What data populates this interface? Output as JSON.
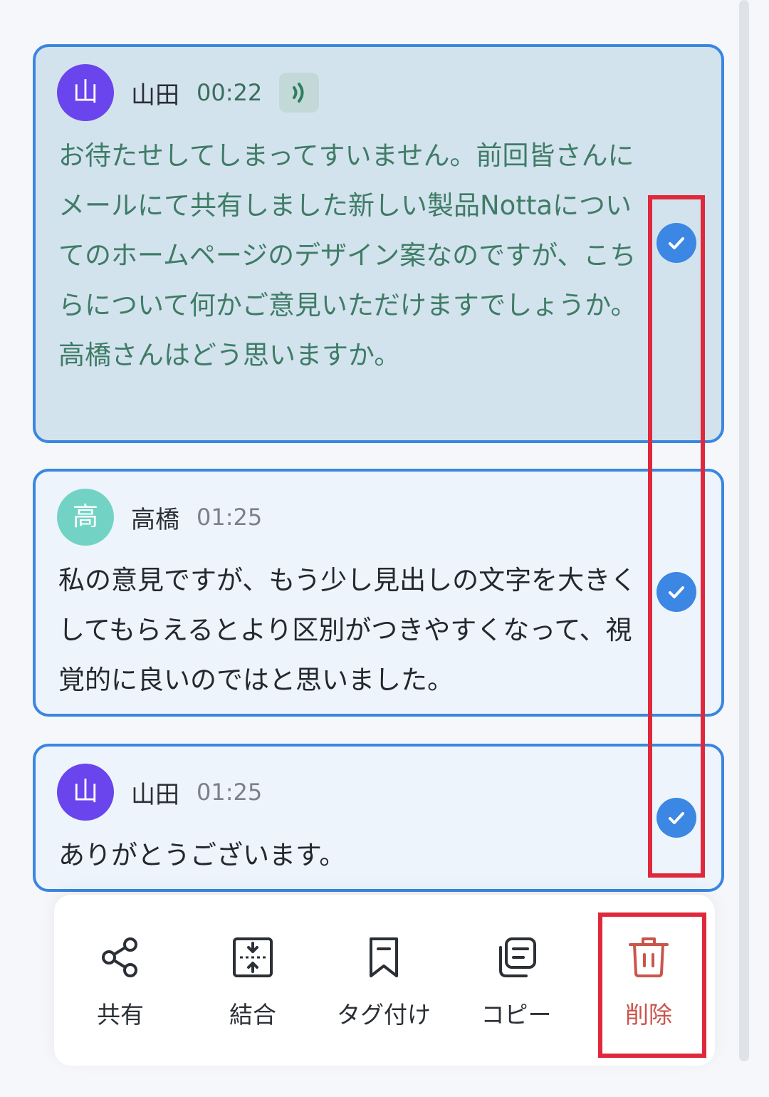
{
  "colors": {
    "selection_border": "#3a86e0",
    "check_blue": "#3b87e3",
    "highlight_red": "#e0283c",
    "delete_red": "#c9554d",
    "avatar_yamada": "#6a44ec",
    "avatar_takahashi": "#72d3c5"
  },
  "transcript": [
    {
      "avatar_char": "山",
      "speaker": "山田",
      "time": "00:22",
      "playing_icon": "audio-wave-icon",
      "text": "お待たせしてしまってすいません。前回皆さんにメールにて共有しました新しい製品Nottaについてのホームページのデザイン案なのですが、こちらについて何かご意見いただけますでしょうか。高橋さんはどう思いますか。",
      "selected": true
    },
    {
      "avatar_char": "高",
      "speaker": "高橋",
      "time": "01:25",
      "text": "私の意見ですが、もう少し見出しの文字を大きくしてもらえるとより区別がつきやすくなって、視覚的に良いのではと思いました。",
      "selected": true
    },
    {
      "avatar_char": "山",
      "speaker": "山田",
      "time": "01:25",
      "text": "ありがとうございます。",
      "selected": true
    }
  ],
  "toolbar": {
    "items": [
      {
        "label": "共有",
        "icon": "share-icon"
      },
      {
        "label": "結合",
        "icon": "merge-icon"
      },
      {
        "label": "タグ付け",
        "icon": "bookmark-icon"
      },
      {
        "label": "コピー",
        "icon": "copy-icon"
      },
      {
        "label": "削除",
        "icon": "trash-icon"
      }
    ]
  }
}
